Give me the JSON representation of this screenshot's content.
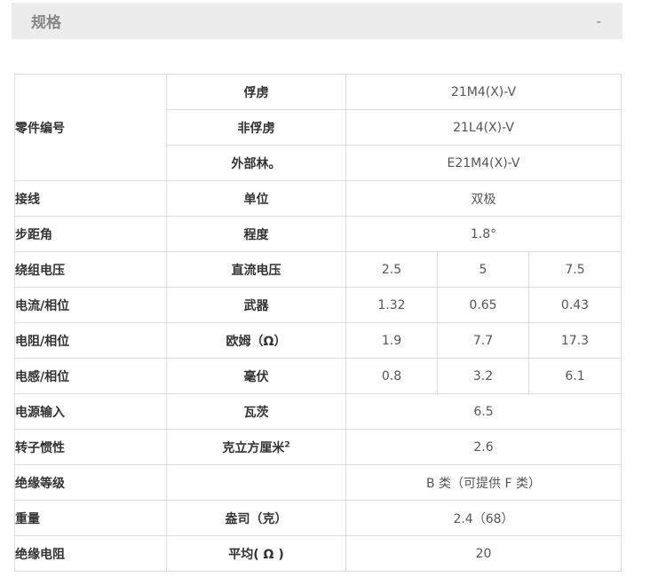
{
  "header": {
    "title": "规格",
    "toggle": "-"
  },
  "table": {
    "part_number": {
      "label": "零件编号",
      "rows": [
        {
          "unit": "俘虏",
          "value": "21M4(X)-V"
        },
        {
          "unit": "非俘虏",
          "value": "21L4(X)-V"
        },
        {
          "unit": "外部林。",
          "value": "E21M4(X)-V"
        }
      ]
    },
    "wiring": {
      "label": "接线",
      "unit": "单位",
      "value": "双极"
    },
    "step_angle": {
      "label": "步距角",
      "unit": "程度",
      "value": "1.8°"
    },
    "winding_voltage": {
      "label": "绕组电压",
      "unit": "直流电压",
      "values": [
        "2.5",
        "5",
        "7.5"
      ]
    },
    "current_phase": {
      "label": "电流/相位",
      "unit": "武器",
      "values": [
        "1.32",
        "0.65",
        "0.43"
      ]
    },
    "resistance_phase": {
      "label": "电阻/相位",
      "unit": "欧姆（Ω）",
      "values": [
        "1.9",
        "7.7",
        "17.3"
      ]
    },
    "inductance_phase": {
      "label": "电感/相位",
      "unit": "毫伏",
      "values": [
        "0.8",
        "3.2",
        "6.1"
      ]
    },
    "power_input": {
      "label": "电源输入",
      "unit": "瓦茨",
      "value": "6.5"
    },
    "rotor_inertia": {
      "label": "转子惯性",
      "unit": "克立方厘米",
      "unit_sup": "2",
      "value": "2.6"
    },
    "insulation_class": {
      "label": "绝缘等级",
      "unit": "",
      "value": "B 类（可提供 F 类）"
    },
    "weight": {
      "label": "重量",
      "unit": "盎司（克）",
      "value": "2.4（68）"
    },
    "insulation_resistance": {
      "label": "绝缘电阻",
      "unit": "平均( Ω )",
      "value": "20"
    }
  }
}
